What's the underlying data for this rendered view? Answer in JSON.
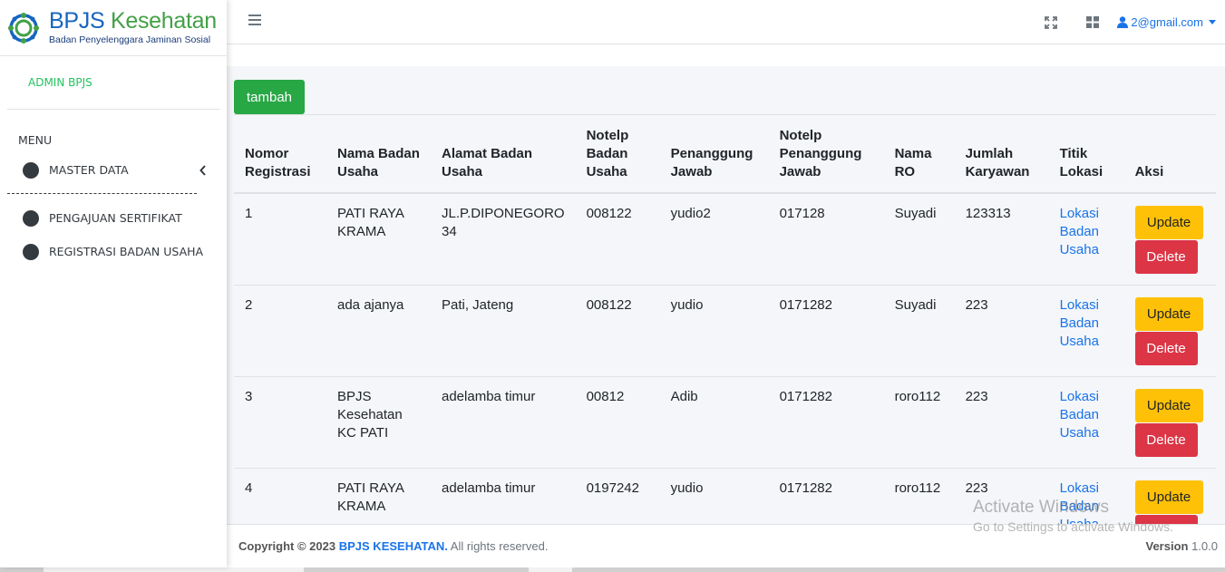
{
  "brand": {
    "name_part1": "BPJS",
    "name_part2": "Kesehatan",
    "tagline": "Badan Penyelenggara Jaminan Sosial",
    "icon": "bpjs-logo",
    "colors": {
      "blue": "#1565c0",
      "green": "#43a047"
    }
  },
  "sidebar": {
    "user": "ADMIN BPJS",
    "menu_header": "MENU",
    "items": [
      {
        "label": "MASTER DATA",
        "has_submenu": true,
        "icon": "circle-icon"
      },
      {
        "label": "PENGAJUAN SERTIFIKAT",
        "icon": "circle-icon"
      },
      {
        "label": "REGISTRASI BADAN USAHA",
        "icon": "circle-icon"
      }
    ]
  },
  "topbar": {
    "menu_icon": "hamburger-icon",
    "fullscreen_icon": "expand-icon",
    "grid_icon": "grid-icon",
    "user_email": "2@gmail.com"
  },
  "main": {
    "add_button": "tambah",
    "table": {
      "headers": [
        "Nomor Registrasi",
        "Nama Badan Usaha",
        "Alamat Badan Usaha",
        "Notelp Badan Usaha",
        "Penanggung Jawab",
        "Notelp Penanggung Jawab",
        "Nama RO",
        "Jumlah Karyawan",
        "Titik Lokasi",
        "Aksi"
      ],
      "rows": [
        {
          "no": "1",
          "nama": "PATI RAYA KRAMA",
          "alamat": "JL.P.DIPONEGORO 34",
          "telp": "008122",
          "pj": "yudio2",
          "telp_pj": "017128",
          "ro": "Suyadi",
          "karyawan": "123313",
          "lokasi": "Lokasi Badan Usaha",
          "update": "Update",
          "delete": "Delete"
        },
        {
          "no": "2",
          "nama": "ada ajanya",
          "alamat": "Pati, Jateng",
          "telp": "008122",
          "pj": "yudio",
          "telp_pj": "0171282",
          "ro": "Suyadi",
          "karyawan": "223",
          "lokasi": "Lokasi Badan Usaha",
          "update": "Update",
          "delete": "Delete"
        },
        {
          "no": "3",
          "nama": "BPJS Kesehatan KC PATI",
          "alamat": "adelamba timur",
          "telp": "00812",
          "pj": "Adib",
          "telp_pj": "0171282",
          "ro": "roro112",
          "karyawan": "223",
          "lokasi": "Lokasi Badan Usaha",
          "update": "Update",
          "delete": "Delete"
        },
        {
          "no": "4",
          "nama": "PATI RAYA KRAMA",
          "alamat": "adelamba timur",
          "telp": "0197242",
          "pj": "yudio",
          "telp_pj": "0171282",
          "ro": "roro112",
          "karyawan": "223",
          "lokasi": "Lokasi Badan Usaha",
          "update": "Update",
          "delete": "Delete"
        }
      ]
    }
  },
  "footer": {
    "copyright_prefix": "Copyright © 2023",
    "brand_link": "BPJS KESEHATAN.",
    "rights": "All rights reserved.",
    "version_label": "Version",
    "version_value": "1.0.0"
  },
  "watermark": {
    "line1": "Activate Windows",
    "line2": "Go to Settings to activate Windows."
  }
}
